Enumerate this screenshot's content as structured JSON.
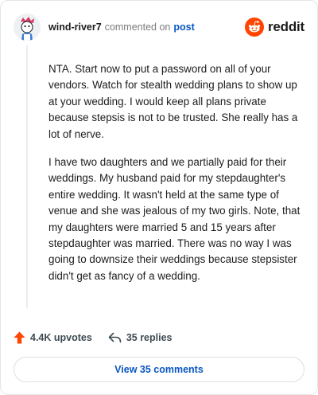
{
  "header": {
    "username": "wind-river7",
    "action_text": "commented on",
    "post_link": "post",
    "logo_text": "reddit"
  },
  "comment": {
    "paragraphs": [
      "NTA. Start now to put a password on all of your vendors. Watch for stealth wedding plans to show up at your wedding. I would keep all plans private because stepsis is not to be trusted. She really has a lot of nerve.",
      "I have two daughters and we partially paid for their weddings. My husband paid for my stepdaughter's entire wedding. It wasn't held at the same type of venue and she was jealous of my two girls. Note, that my daughters were married 5 and 15 years after stepdaughter was married. There was no way I was going to downsize their weddings because stepsister didn't get as fancy of a wedding."
    ]
  },
  "footer": {
    "upvotes": "4.4K upvotes",
    "replies": "35 replies",
    "view_comments": "View 35 comments"
  },
  "colors": {
    "brand": "#ff4500",
    "link": "#0a57c2",
    "upvote": "#ff4500"
  },
  "icons": [
    "avatar",
    "reddit-logo-icon",
    "upvote-arrow-icon",
    "reply-arrow-icon"
  ]
}
